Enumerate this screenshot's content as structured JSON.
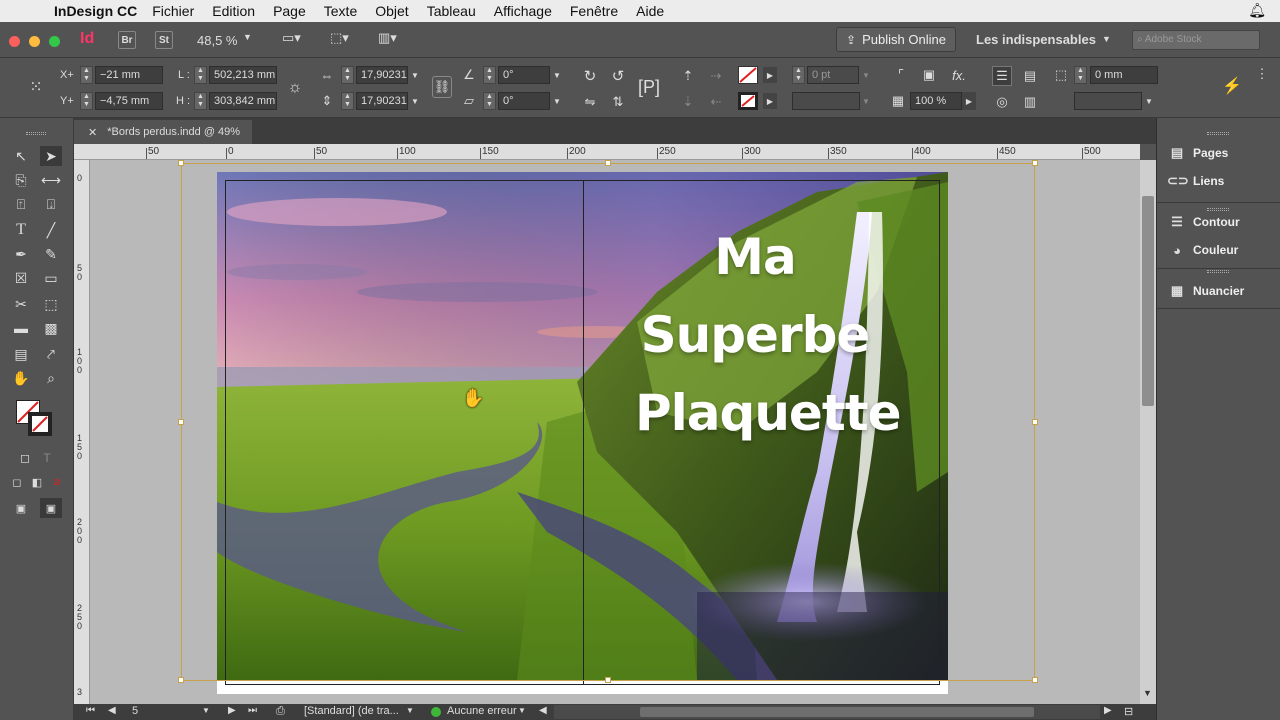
{
  "menubar": {
    "app_name": "InDesign CC",
    "items": [
      "Fichier",
      "Edition",
      "Page",
      "Texte",
      "Objet",
      "Tableau",
      "Affichage",
      "Fenêtre",
      "Aide"
    ]
  },
  "appbar": {
    "logo": "Id",
    "bridge": "Br",
    "stock": "St",
    "zoom": "48,5 %",
    "publish": "Publish Online",
    "workspace": "Les indispensables",
    "search_placeholder": "Adobe Stock"
  },
  "control": {
    "x_label": "X+",
    "y_label": "Y+",
    "x_value": "−21 mm",
    "y_value": "−4,75 mm",
    "w_label": "L :",
    "h_label": "H :",
    "w_value": "502,213 mm",
    "h_value": "303,842 mm",
    "scale_x": "17,90231",
    "scale_y": "17,90231",
    "angle": "0°",
    "shear": "0°",
    "stroke_weight": "0 pt",
    "opacity": "100 %",
    "offset": "0 mm"
  },
  "document": {
    "tab_label": "*Bords perdus.indd @ 49%",
    "headline": [
      "Ma",
      "Superbe",
      "Plaquette"
    ]
  },
  "hruler_labels": [
    "50",
    "0",
    "50",
    "100",
    "150",
    "200",
    "250",
    "300",
    "350",
    "400",
    "450",
    "500"
  ],
  "vruler_labels": [
    "0",
    "5 0",
    "1 0 0",
    "1 5 0",
    "2 0 0",
    "2 5 0",
    "3"
  ],
  "status": {
    "page_number": "5",
    "master": "[Standard] (de tra...",
    "errors": "Aucune erreur"
  },
  "panels": [
    {
      "label": "Pages",
      "icon": "pages-icon"
    },
    {
      "label": "Liens",
      "icon": "links-icon"
    },
    {
      "label": "Contour",
      "icon": "stroke-icon"
    },
    {
      "label": "Couleur",
      "icon": "color-icon"
    },
    {
      "label": "Nuancier",
      "icon": "swatches-icon"
    }
  ],
  "colors": {
    "accent_frame": "#c8a24a",
    "close_dot": "#fc605c",
    "min_dot": "#fdbc40",
    "max_dot": "#34c84a",
    "id_logo": "#ff3366"
  }
}
